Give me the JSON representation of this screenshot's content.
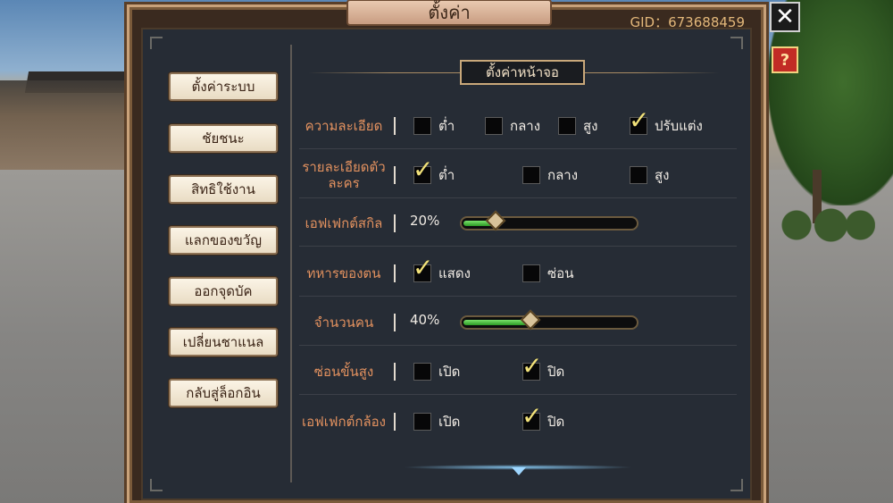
{
  "window": {
    "title": "ตั้งค่า",
    "gid_label": "GID：673688459"
  },
  "menu": [
    {
      "label": "ตั้งค่าระบบ"
    },
    {
      "label": "ชัยชนะ"
    },
    {
      "label": "สิทธิใช้งาน"
    },
    {
      "label": "แลกของขวัญ"
    },
    {
      "label": "ออกจุดบัค"
    },
    {
      "label": "เปลี่ยนชาแนล"
    },
    {
      "label": "กลับสู่ล็อกอิน"
    }
  ],
  "section": {
    "title": "ตั้งค่าหน้าจอ"
  },
  "rows": [
    {
      "label": "ความละเอียด",
      "options": [
        {
          "label": "ต่ำ",
          "checked": false
        },
        {
          "label": "กลาง",
          "checked": false
        },
        {
          "label": "สูง",
          "checked": false
        },
        {
          "label": "ปรับแต่ง",
          "checked": true
        }
      ]
    },
    {
      "label": "รายละเอียดตัวละคร",
      "options": [
        {
          "label": "ต่ำ",
          "checked": true
        },
        {
          "label": "กลาง",
          "checked": false
        },
        {
          "label": "สูง",
          "checked": false
        }
      ]
    },
    {
      "label": "เอฟเฟกต์สกิล",
      "value_label": "20%",
      "value": 0.2
    },
    {
      "label": "ทหารของตน",
      "options": [
        {
          "label": "แสดง",
          "checked": true
        },
        {
          "label": "ซ่อน",
          "checked": false
        }
      ]
    },
    {
      "label": "จำนวนคน",
      "value_label": "40%",
      "value": 0.4
    },
    {
      "label": "ซ่อนขั้นสูง",
      "options": [
        {
          "label": "เปิด",
          "checked": false
        },
        {
          "label": "ปิด",
          "checked": true
        }
      ]
    },
    {
      "label": "เอฟเฟกต์กล้อง",
      "options": [
        {
          "label": "เปิด",
          "checked": false
        },
        {
          "label": "ปิด",
          "checked": true
        }
      ]
    }
  ],
  "controls": {
    "close_symbol": "✕",
    "help_symbol": "?",
    "check_symbol": "✓"
  },
  "icons": {
    "close": "close-icon",
    "help": "help-icon",
    "scroll": "chevron-down-icon"
  },
  "colors": {
    "label_orange": "#e2915f",
    "check_yellow": "#f2e27a",
    "slider_green": "#3fbf3a"
  }
}
